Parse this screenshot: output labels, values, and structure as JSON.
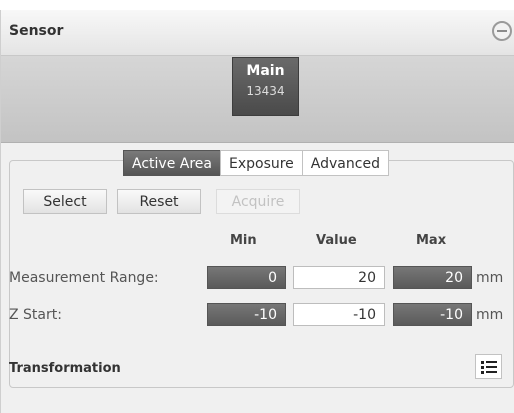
{
  "panel": {
    "title": "Sensor"
  },
  "sensor": {
    "name": "Main",
    "id": "13434"
  },
  "tabs": [
    "Active Area",
    "Exposure",
    "Advanced"
  ],
  "buttons": {
    "select": "Select",
    "reset": "Reset",
    "acquire": "Acquire"
  },
  "columns": {
    "min": "Min",
    "value": "Value",
    "max": "Max"
  },
  "rows": [
    {
      "label": "Measurement Range:",
      "min": "0",
      "value": "20",
      "max": "20",
      "unit": "mm"
    },
    {
      "label": "Z Start:",
      "min": "-10",
      "value": "-10",
      "max": "-10",
      "unit": "mm"
    }
  ],
  "transformation": {
    "label": "Transformation"
  },
  "icons": {
    "collapse": "minus-circle-icon",
    "list": "list-icon"
  }
}
